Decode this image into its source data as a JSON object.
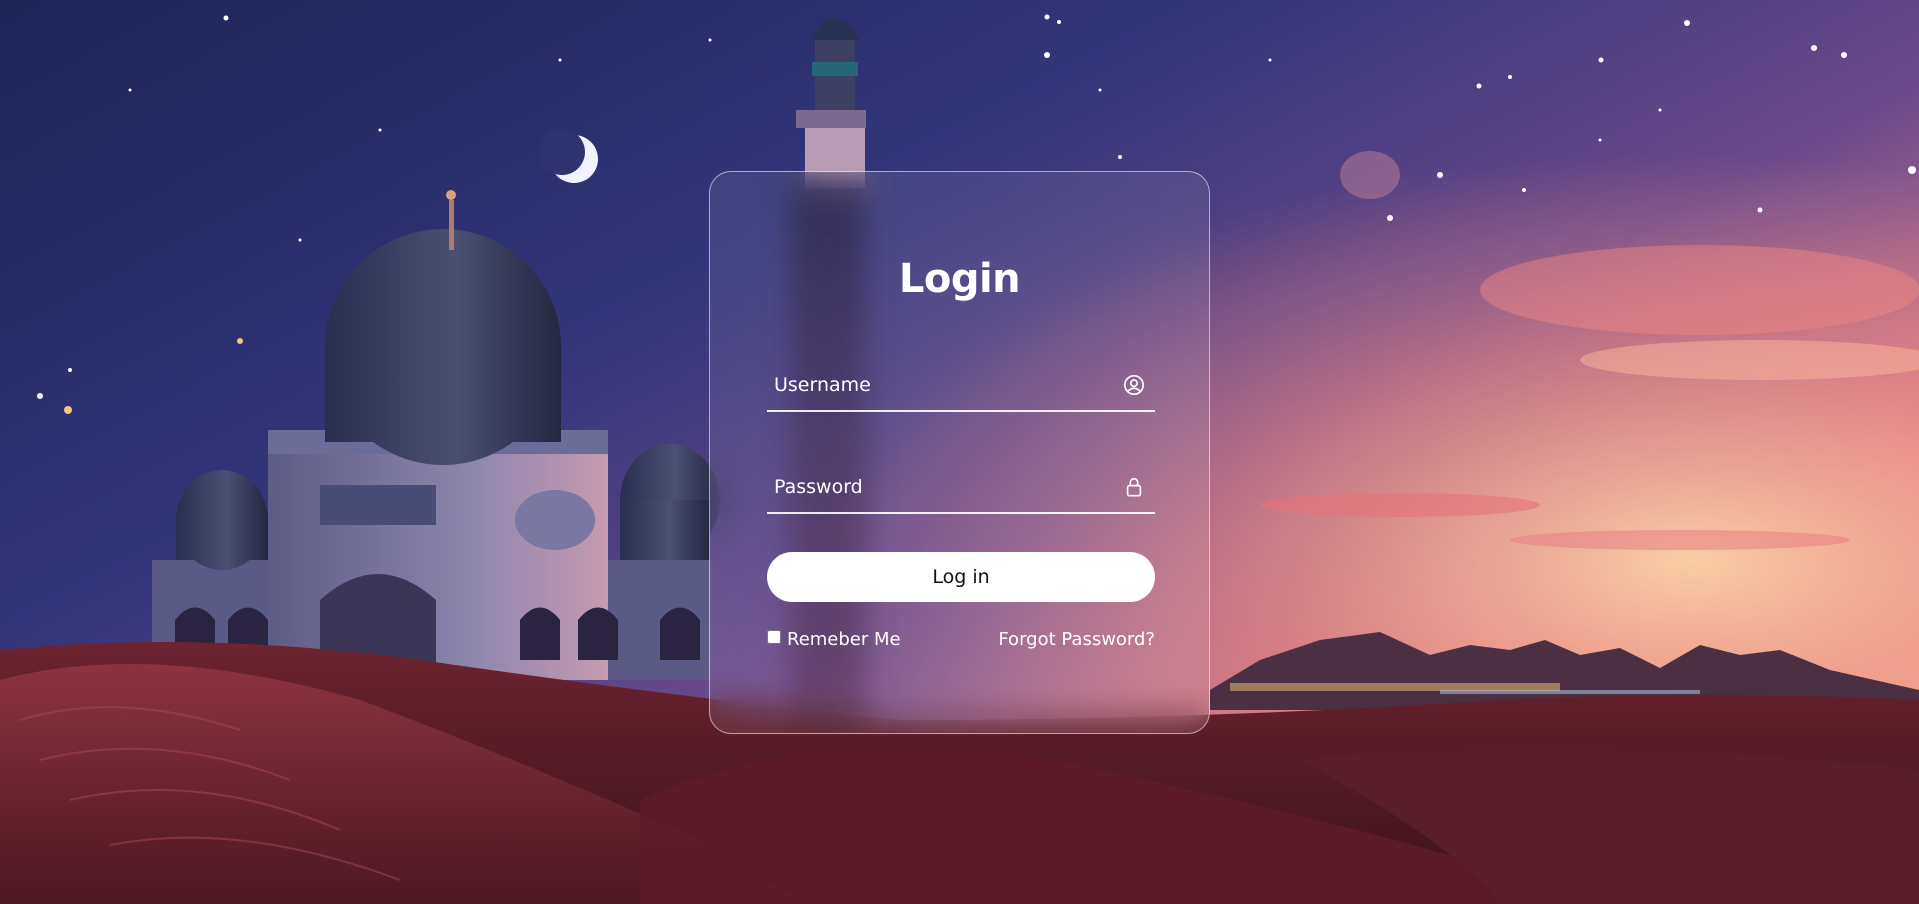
{
  "login": {
    "title": "Login",
    "username_placeholder": "Username",
    "password_placeholder": "Password",
    "submit_label": "Log in",
    "remember_label": "Remeber Me",
    "forgot_label": "Forgot Password?"
  },
  "icons": {
    "username": "user-circle-icon",
    "password": "lock-icon"
  },
  "colors": {
    "sky_top": "#2a2f6a",
    "sky_sunset": "#f08a80",
    "sand": "#7a2a35",
    "card_border": "#ffffff",
    "button_bg": "#ffffff"
  }
}
